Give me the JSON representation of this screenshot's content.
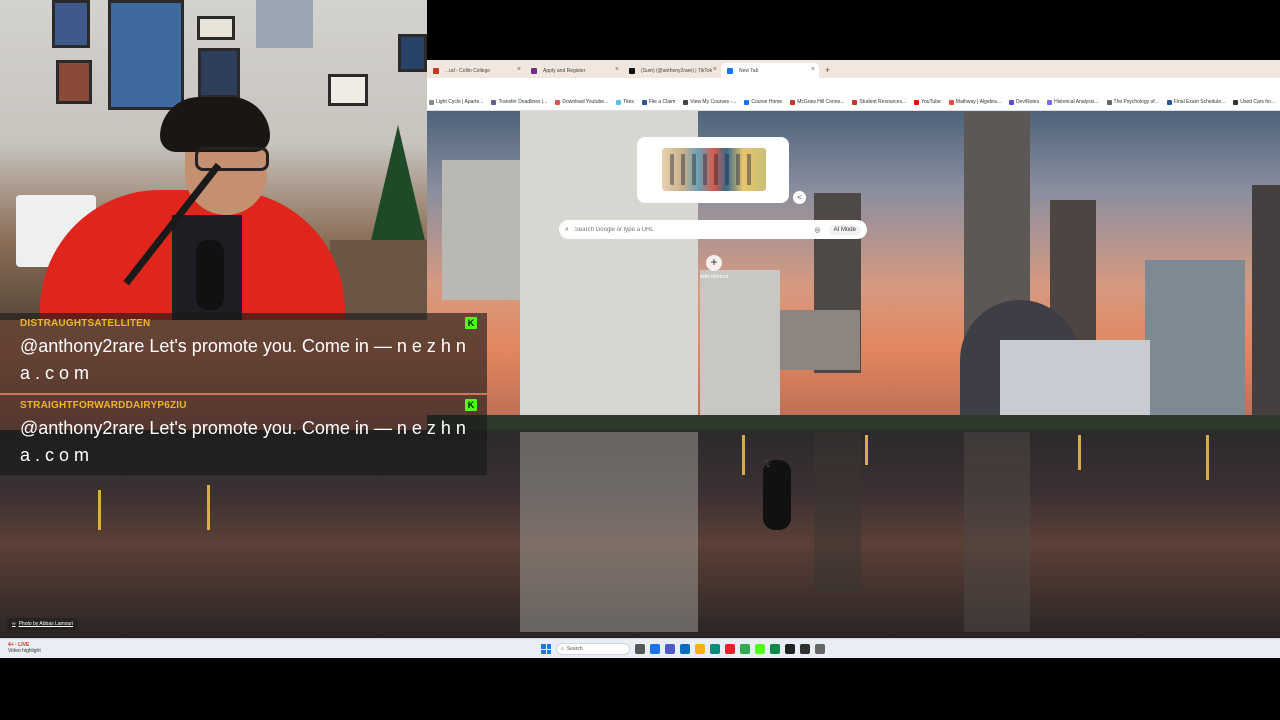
{
  "browser": {
    "tabs": [
      {
        "label": "...ud - Collin College",
        "color": "#c0392b",
        "active": false
      },
      {
        "label": "Apply and Register",
        "color": "#7a2a8a",
        "active": false
      },
      {
        "label": "(Sum) (@anthony2rare) | TikTok",
        "color": "#111111",
        "active": false
      },
      {
        "label": "New Tab",
        "color": "#1a73e8",
        "active": true
      }
    ],
    "bookmarks": [
      {
        "label": "Light Cycle | Aparte...",
        "color": "#888888"
      },
      {
        "label": "Transfer Deadlines |...",
        "color": "#6b5b95"
      },
      {
        "label": "Download Youtube...",
        "color": "#d9534f"
      },
      {
        "label": "Tites",
        "color": "#5bc0de"
      },
      {
        "label": "File a Claim",
        "color": "#2b5797"
      },
      {
        "label": "View My Courses -...",
        "color": "#444444"
      },
      {
        "label": "Course Home",
        "color": "#1a73e8"
      },
      {
        "label": "McGraw Hill Conne...",
        "color": "#c0392b"
      },
      {
        "label": "Student Resources...",
        "color": "#c0392b"
      },
      {
        "label": "YouTube",
        "color": "#ff0000"
      },
      {
        "label": "Mathway | Algebra...",
        "color": "#e74c3c"
      },
      {
        "label": "DeviNotes",
        "color": "#5a4fcf"
      },
      {
        "label": "Historical Analysis...",
        "color": "#7b68ee"
      },
      {
        "label": "The Psychology of...",
        "color": "#666666"
      },
      {
        "label": "Final Exam Schedule...",
        "color": "#2b5797"
      },
      {
        "label": "Used Cars for...",
        "color": "#333333"
      }
    ]
  },
  "newtab": {
    "search_placeholder": "Search Google or type a URL",
    "ai_mode_label": "AI Mode",
    "add_shortcut_label": "Add shortcut",
    "photo_credit": "Photo by Abbas Lamouri"
  },
  "taskbar": {
    "weather_line1": "4+ · LIVE",
    "weather_line2": "Video highlight",
    "search_label": "Search",
    "apps": [
      {
        "name": "task-view",
        "color": "#555555"
      },
      {
        "name": "chrome",
        "color": "#1a73e8"
      },
      {
        "name": "teams",
        "color": "#5059c9"
      },
      {
        "name": "mail",
        "color": "#0f6cbd"
      },
      {
        "name": "files",
        "color": "#f2b01e"
      },
      {
        "name": "edge",
        "color": "#0c8a7a"
      },
      {
        "name": "opera",
        "color": "#e0262c"
      },
      {
        "name": "chrome-2",
        "color": "#34a853"
      },
      {
        "name": "kick",
        "color": "#53fc18"
      },
      {
        "name": "app-green",
        "color": "#0b8a4a"
      },
      {
        "name": "terminal",
        "color": "#222222"
      },
      {
        "name": "obs",
        "color": "#303030"
      },
      {
        "name": "settings",
        "color": "#666666"
      }
    ]
  },
  "chat": {
    "messages": [
      {
        "username": "DISTRAUGHTSATELLITEN",
        "badge": "K",
        "text": "@anthony2rare Let's promote you. Come in — n e z h n a . c o m"
      },
      {
        "username": "STRAIGHTFORWARDDAIRYP6ZIU",
        "badge": "K",
        "text": "@anthony2rare Let's promote you. Come in — n e z h n a . c o m"
      }
    ]
  }
}
